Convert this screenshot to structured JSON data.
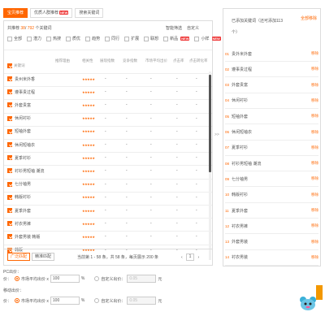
{
  "tabs": [
    {
      "label": "宝贝推荐",
      "active": true,
      "new": false
    },
    {
      "label": "优质人群推荐",
      "active": false,
      "new": true,
      "badge": "NEW"
    },
    {
      "label": "搜索关键词",
      "active": false,
      "new": false
    }
  ],
  "summary": {
    "prefix": "共推荐",
    "selected": "38",
    "sep": "/",
    "total": "792",
    "suffix": "个关键词"
  },
  "actions": {
    "filter": "智能筛选",
    "custom": "自定义"
  },
  "filters": [
    {
      "label": "全部",
      "checked": false
    },
    {
      "label": "潜力",
      "checked": false
    },
    {
      "label": "热搜",
      "checked": false
    },
    {
      "label": "质优",
      "checked": false
    },
    {
      "label": "趋势",
      "checked": false
    },
    {
      "label": "同行",
      "checked": false
    },
    {
      "label": "扩展",
      "checked": false
    },
    {
      "label": "联想",
      "checked": false
    },
    {
      "label": "新品",
      "checked": false,
      "badge": "NEW"
    },
    {
      "label": "小样",
      "checked": false,
      "badge": "NEW"
    }
  ],
  "columns": [
    "关键词",
    "推荐理由",
    "相关性",
    "展现指数",
    "竞争指数",
    "市场平均出价",
    "点击率",
    "点击转化率"
  ],
  "rows": [
    {
      "kw": "贵州米外香",
      "stars": "★★★★★",
      "v1": "-",
      "v2": "-",
      "v3": "-",
      "v4": "-",
      "v5": "-"
    },
    {
      "kw": "遵事贵过程",
      "stars": "★★★★★",
      "v1": "-",
      "v2": "-",
      "v3": "-",
      "v4": "-",
      "v5": "-"
    },
    {
      "kw": "外套贵富",
      "stars": "★★★★★",
      "v1": "-",
      "v2": "-",
      "v3": "-",
      "v4": "-",
      "v5": "-"
    },
    {
      "kw": "休闲衬衫",
      "stars": "★★★★★",
      "v1": "-",
      "v2": "-",
      "v3": "-",
      "v4": "-",
      "v5": "-"
    },
    {
      "kw": "短袖外套",
      "stars": "★★★★★",
      "v1": "-",
      "v2": "-",
      "v3": "-",
      "v4": "-",
      "v5": "-"
    },
    {
      "kw": "休闲短袖衣",
      "stars": "★★★★★",
      "v1": "-",
      "v2": "-",
      "v3": "-",
      "v4": "-",
      "v5": "-"
    },
    {
      "kw": "夏季衬衫",
      "stars": "★★★★★",
      "v1": "-",
      "v2": "-",
      "v3": "-",
      "v4": "-",
      "v5": "-"
    },
    {
      "kw": "衬衫男短袖 潮流",
      "stars": "★★★★★",
      "v1": "-",
      "v2": "-",
      "v3": "-",
      "v4": "-",
      "v5": "-"
    },
    {
      "kw": "七分袖男",
      "stars": "★★★★★",
      "v1": "-",
      "v2": "-",
      "v3": "-",
      "v4": "-",
      "v5": "-"
    },
    {
      "kw": "韩版衬衫",
      "stars": "★★★★★",
      "v1": "-",
      "v2": "-",
      "v3": "-",
      "v4": "-",
      "v5": "-"
    },
    {
      "kw": "夏季外套",
      "stars": "★★★★★",
      "v1": "-",
      "v2": "-",
      "v3": "-",
      "v4": "-",
      "v5": "-"
    },
    {
      "kw": "衬衣男裤",
      "stars": "★★★★★",
      "v1": "-",
      "v2": "-",
      "v3": "-",
      "v4": "-",
      "v5": "-"
    },
    {
      "kw": "外套男装 韩版",
      "stars": "★★★★★",
      "v1": "-",
      "v2": "-",
      "v3": "-",
      "v4": "-",
      "v5": "-"
    },
    {
      "kw": "韩版",
      "stars": "★★★★★",
      "v1": "-",
      "v2": "-",
      "v3": "-",
      "v4": "-",
      "v5": "-"
    }
  ],
  "footer": {
    "match_broad": "广泛匹配",
    "match_exact": "精准匹配",
    "page_info": "当前第 1 - 58 条，共 58 条，每页展示 200 条",
    "page": "1"
  },
  "transfer": ">>",
  "right": {
    "title": "已添加关键词（还可添加113个）",
    "title_line1": "已添加关键词（还可添加113",
    "title_line2": "个）",
    "remove_all": "全部移除",
    "remove": "移除",
    "items": [
      {
        "n": "01",
        "t": "贵外米外套"
      },
      {
        "n": "02",
        "t": "遵事贵过程"
      },
      {
        "n": "03",
        "t": "外套贵富"
      },
      {
        "n": "04",
        "t": "休闲衬衫"
      },
      {
        "n": "05",
        "t": "短袖外套"
      },
      {
        "n": "06",
        "t": "休闲短袖衣"
      },
      {
        "n": "07",
        "t": "夏季衬衫"
      },
      {
        "n": "08",
        "t": "衬衫男短袖 潮流"
      },
      {
        "n": "09",
        "t": "七分袖男"
      },
      {
        "n": "10",
        "t": "韩版衬衫"
      },
      {
        "n": "11",
        "t": "夏季外套"
      },
      {
        "n": "12",
        "t": "衬衣男裤"
      },
      {
        "n": "13",
        "t": "外套男装"
      },
      {
        "n": "14",
        "t": "衬衣男装"
      }
    ]
  },
  "pc_bid": {
    "title": "PC出价：",
    "opt1": "市场平均出价 x",
    "value": "100",
    "unit": "%",
    "opt2": "自定义出价：",
    "custom": "0.05",
    "currency": "元"
  },
  "mobile_bid": {
    "title": "移动出价：",
    "opt1": "市场平均出价 x",
    "value": "100",
    "unit": "%",
    "opt2": "自定义出价：",
    "custom": "0.05",
    "currency": "元"
  },
  "colors": {
    "accent": "#ff6600"
  }
}
